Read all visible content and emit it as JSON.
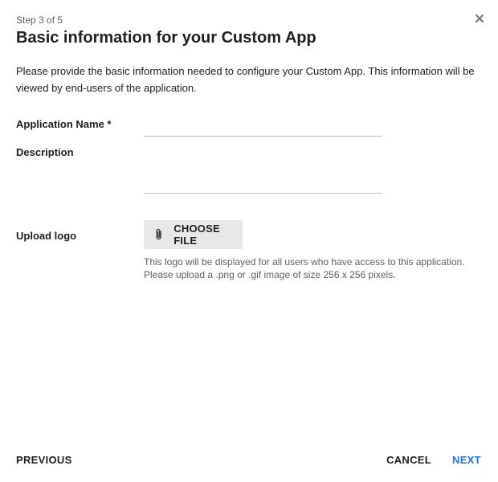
{
  "dialog": {
    "step_label": "Step 3 of 5",
    "title": "Basic information for your Custom App",
    "intro": "Please provide the basic information needed to configure your Custom App. This information will be viewed by end-users of the application.",
    "close_icon": "close-icon"
  },
  "form": {
    "app_name": {
      "label": "Application Name *",
      "value": ""
    },
    "description": {
      "label": "Description",
      "value": ""
    },
    "logo": {
      "label": "Upload logo",
      "button_label": "CHOOSE FILE",
      "button_icon": "paperclip-icon",
      "help_line1": "This logo will be displayed for all users who have access to this application.",
      "help_line2": "Please upload a .png or .gif image of size 256 x 256 pixels."
    }
  },
  "footer": {
    "previous_label": "PREVIOUS",
    "cancel_label": "CANCEL",
    "next_label": "NEXT"
  },
  "colors": {
    "accent": "#1a73e8",
    "text": "#212121",
    "secondary_text": "#616161",
    "button_bg": "#e8e8e8"
  }
}
